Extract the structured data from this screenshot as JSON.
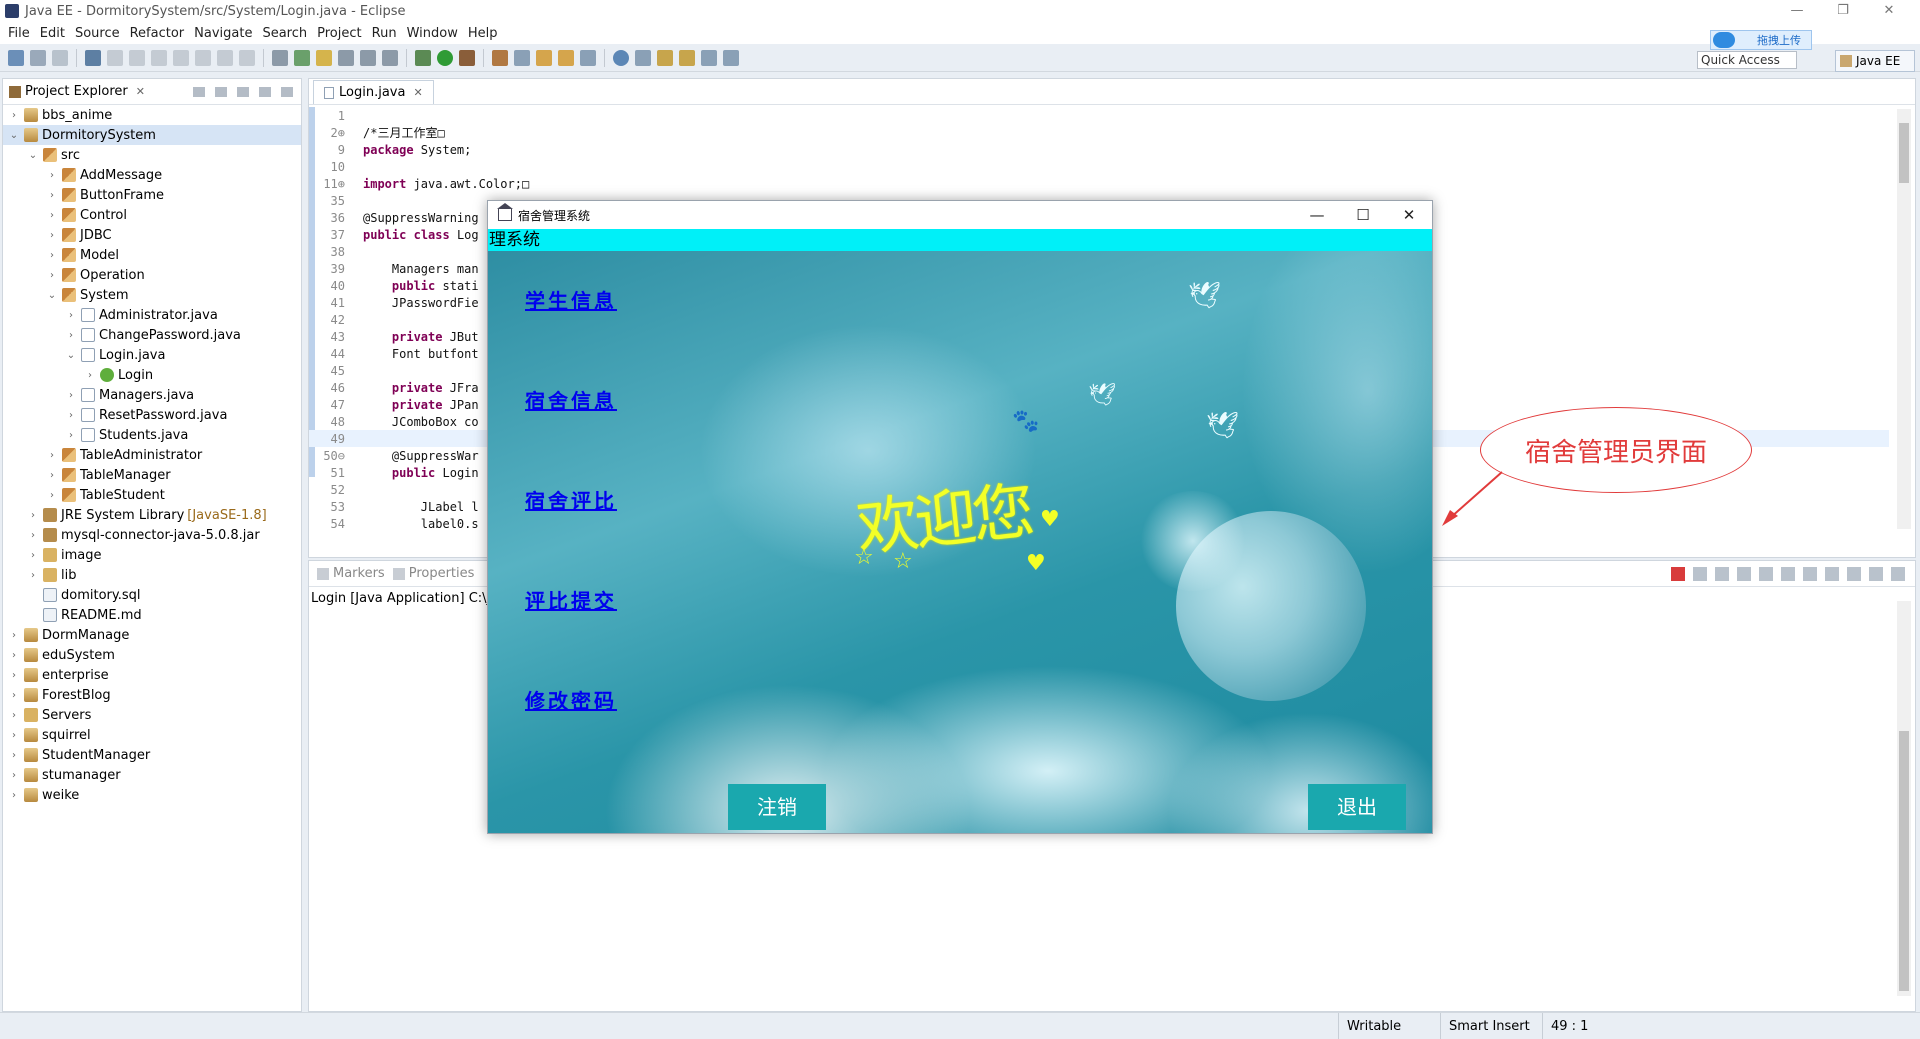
{
  "window": {
    "title": "Java EE - DormitorySystem/src/System/Login.java - Eclipse",
    "controls": [
      "—",
      "❐",
      "✕"
    ]
  },
  "menu": [
    "File",
    "Edit",
    "Source",
    "Refactor",
    "Navigate",
    "Search",
    "Project",
    "Run",
    "Window",
    "Help"
  ],
  "toolbar": {
    "upload_label": "拖拽上传",
    "quick_access": "Quick Access",
    "perspective": "Java EE"
  },
  "explorer": {
    "title": "Project Explorer",
    "close": "✕",
    "items": [
      {
        "label": "bbs_anime",
        "indent": 0,
        "arrow": ">",
        "icon": "proj"
      },
      {
        "label": "DormitorySystem",
        "indent": 0,
        "arrow": "v",
        "icon": "proj",
        "selected": true
      },
      {
        "label": "src",
        "indent": 1,
        "arrow": "v",
        "icon": "pkg"
      },
      {
        "label": "AddMessage",
        "indent": 2,
        "arrow": ">",
        "icon": "pkg"
      },
      {
        "label": "ButtonFrame",
        "indent": 2,
        "arrow": ">",
        "icon": "pkg"
      },
      {
        "label": "Control",
        "indent": 2,
        "arrow": ">",
        "icon": "pkg"
      },
      {
        "label": "JDBC",
        "indent": 2,
        "arrow": ">",
        "icon": "pkg"
      },
      {
        "label": "Model",
        "indent": 2,
        "arrow": ">",
        "icon": "pkg"
      },
      {
        "label": "Operation",
        "indent": 2,
        "arrow": ">",
        "icon": "pkg"
      },
      {
        "label": "System",
        "indent": 2,
        "arrow": "v",
        "icon": "pkg"
      },
      {
        "label": "Administrator.java",
        "indent": 3,
        "arrow": ">",
        "icon": "java"
      },
      {
        "label": "ChangePassword.java",
        "indent": 3,
        "arrow": ">",
        "icon": "java"
      },
      {
        "label": "Login.java",
        "indent": 3,
        "arrow": "v",
        "icon": "java"
      },
      {
        "label": "Login",
        "indent": 4,
        "arrow": ">",
        "icon": "cls"
      },
      {
        "label": "Managers.java",
        "indent": 3,
        "arrow": ">",
        "icon": "java"
      },
      {
        "label": "ResetPassword.java",
        "indent": 3,
        "arrow": ">",
        "icon": "java"
      },
      {
        "label": "Students.java",
        "indent": 3,
        "arrow": ">",
        "icon": "java"
      },
      {
        "label": "TableAdministrator",
        "indent": 2,
        "arrow": ">",
        "icon": "pkg"
      },
      {
        "label": "TableManager",
        "indent": 2,
        "arrow": ">",
        "icon": "pkg"
      },
      {
        "label": "TableStudent",
        "indent": 2,
        "arrow": ">",
        "icon": "pkg"
      },
      {
        "label": "JRE System Library",
        "suffix": "[JavaSE-1.8]",
        "indent": 1,
        "arrow": ">",
        "icon": "lib"
      },
      {
        "label": "mysql-connector-java-5.0.8.jar",
        "indent": 1,
        "arrow": ">",
        "icon": "lib"
      },
      {
        "label": "image",
        "indent": 1,
        "arrow": ">",
        "icon": "folder"
      },
      {
        "label": "lib",
        "indent": 1,
        "arrow": ">",
        "icon": "folder"
      },
      {
        "label": "domitory.sql",
        "indent": 1,
        "arrow": "",
        "icon": "file"
      },
      {
        "label": "README.md",
        "indent": 1,
        "arrow": "",
        "icon": "file"
      },
      {
        "label": "DormManage",
        "indent": 0,
        "arrow": ">",
        "icon": "proj"
      },
      {
        "label": "eduSystem",
        "indent": 0,
        "arrow": ">",
        "icon": "proj"
      },
      {
        "label": "enterprise",
        "indent": 0,
        "arrow": ">",
        "icon": "proj"
      },
      {
        "label": "ForestBlog",
        "indent": 0,
        "arrow": ">",
        "icon": "proj"
      },
      {
        "label": "Servers",
        "indent": 0,
        "arrow": ">",
        "icon": "folder"
      },
      {
        "label": "squirrel",
        "indent": 0,
        "arrow": ">",
        "icon": "proj"
      },
      {
        "label": "StudentManager",
        "indent": 0,
        "arrow": ">",
        "icon": "proj"
      },
      {
        "label": "stumanager",
        "indent": 0,
        "arrow": ">",
        "icon": "proj"
      },
      {
        "label": "weike",
        "indent": 0,
        "arrow": ">",
        "icon": "proj"
      }
    ]
  },
  "editor": {
    "tab": "Login.java",
    "lines": [
      {
        "n": "1",
        "t": ""
      },
      {
        "n": "2⊕",
        "t": "/*三月工作室□"
      },
      {
        "n": "9",
        "t": "package System;"
      },
      {
        "n": "10",
        "t": ""
      },
      {
        "n": "11⊕",
        "t": "import java.awt.Color;□"
      },
      {
        "n": "35",
        "t": ""
      },
      {
        "n": "36",
        "t": "@SuppressWarning"
      },
      {
        "n": "37",
        "t": "public class Log"
      },
      {
        "n": "38",
        "t": ""
      },
      {
        "n": "39",
        "t": "    Managers man"
      },
      {
        "n": "40",
        "t": "    public stati"
      },
      {
        "n": "41",
        "t": "    JPasswordFie"
      },
      {
        "n": "42",
        "t": ""
      },
      {
        "n": "43",
        "t": "    private JBut"
      },
      {
        "n": "44",
        "t": "    Font butfont"
      },
      {
        "n": "45",
        "t": ""
      },
      {
        "n": "46",
        "t": "    private JFra"
      },
      {
        "n": "47",
        "t": "    private JPan"
      },
      {
        "n": "48",
        "t": "    JComboBox co"
      },
      {
        "n": "49",
        "t": "",
        "current": true
      },
      {
        "n": "50⊖",
        "t": "    @SuppressWar"
      },
      {
        "n": "51",
        "t": "    public Login"
      },
      {
        "n": "52",
        "t": ""
      },
      {
        "n": "53",
        "t": "        JLabel l"
      },
      {
        "n": "54",
        "t": "        label0.s"
      }
    ]
  },
  "console": {
    "tabs": [
      "Markers",
      "Properties"
    ],
    "title": "Login [Java Application] C:\\java"
  },
  "status": {
    "writable": "Writable",
    "insert": "Smart Insert",
    "position": "49 : 1"
  },
  "app": {
    "title": "宿舍管理系统",
    "header": "理系统",
    "controls": [
      "—",
      "☐",
      "✕"
    ],
    "links": [
      "学生信息",
      "宿舍信息",
      "宿舍评比",
      "评比提交",
      "修改密码"
    ],
    "welcome": "欢迎您",
    "logout": "注销",
    "exit": "退出"
  },
  "annotation": "宿舍管理员界面",
  "colors": {
    "accent": "#00f0f8",
    "button": "#1aa8ae",
    "link": "#0000ee",
    "welcome": "#f3ff27",
    "annotation": "#e13b3b"
  }
}
